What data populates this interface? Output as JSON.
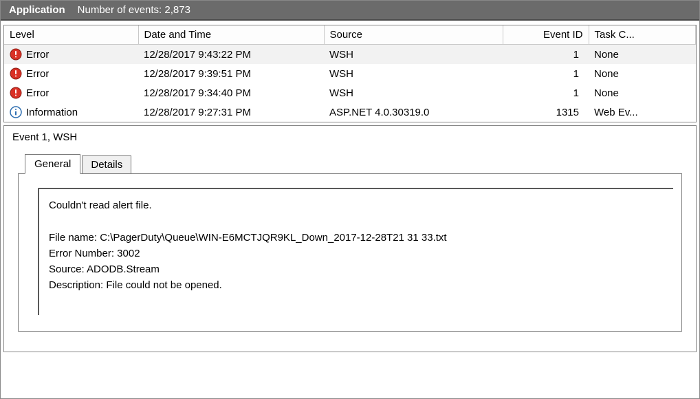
{
  "titlebar": {
    "app_name": "Application",
    "event_count_label": "Number of events: 2,873"
  },
  "columns": {
    "level": "Level",
    "datetime": "Date and Time",
    "source": "Source",
    "eventid": "Event ID",
    "task": "Task C..."
  },
  "rows": [
    {
      "icon": "error",
      "level": "Error",
      "datetime": "12/28/2017 9:43:22 PM",
      "source": "WSH",
      "eventid": "1",
      "task": "None",
      "selected": true
    },
    {
      "icon": "error",
      "level": "Error",
      "datetime": "12/28/2017 9:39:51 PM",
      "source": "WSH",
      "eventid": "1",
      "task": "None",
      "selected": false
    },
    {
      "icon": "error",
      "level": "Error",
      "datetime": "12/28/2017 9:34:40 PM",
      "source": "WSH",
      "eventid": "1",
      "task": "None",
      "selected": false
    },
    {
      "icon": "info",
      "level": "Information",
      "datetime": "12/28/2017 9:27:31 PM",
      "source": "ASP.NET 4.0.30319.0",
      "eventid": "1315",
      "task": "Web Ev...",
      "selected": false
    }
  ],
  "details": {
    "header": "Event 1, WSH",
    "tabs": {
      "general": "General",
      "details": "Details"
    },
    "message": {
      "l1": "Couldn't read alert file.",
      "l2": "",
      "l3": "File name: C:\\PagerDuty\\Queue\\WIN-E6MCTJQR9KL_Down_2017-12-28T21 31 33.txt",
      "l4": "Error Number: 3002",
      "l5": "Source: ADODB.Stream",
      "l6": "Description: File could not be opened."
    }
  }
}
